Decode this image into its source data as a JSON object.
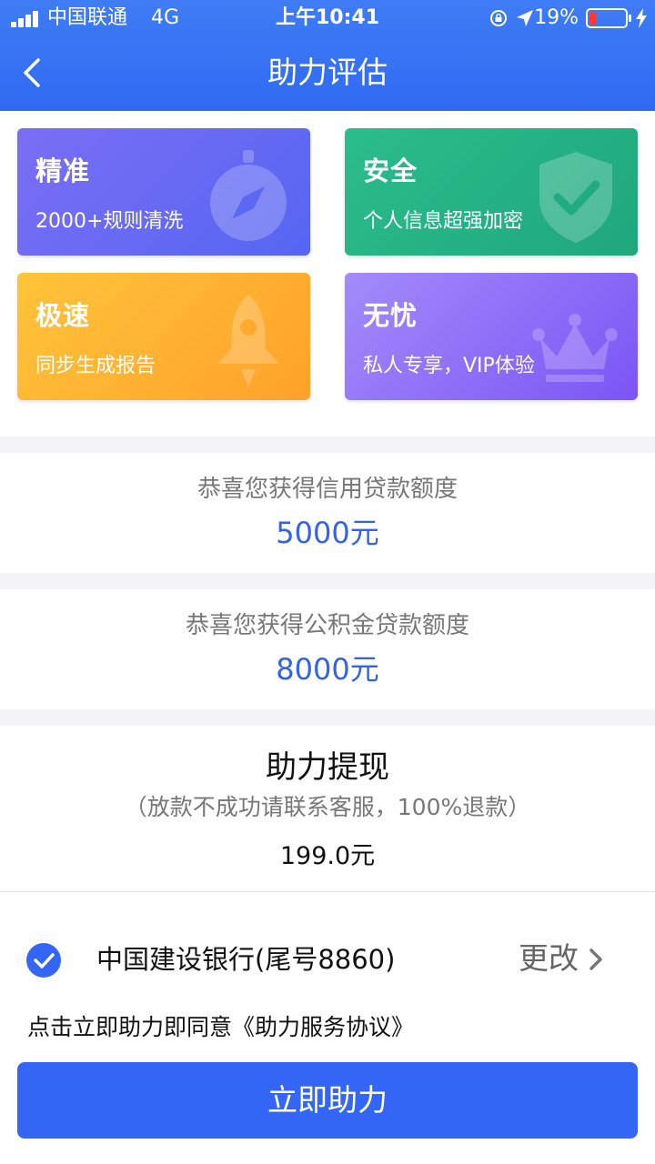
{
  "status_bar": {
    "carrier": "中国联通",
    "network": "4G",
    "time": "上午10:41",
    "battery_percent": "19%",
    "battery_level": 0.19,
    "battery_color": "#ff3b30"
  },
  "nav": {
    "back_icon": "chevron-left-icon",
    "title": "助力评估"
  },
  "features": [
    {
      "title": "精准",
      "desc": "2000+规则清洗",
      "icon": "compass-icon",
      "colors": [
        "#7b6ef5",
        "#5566f2"
      ]
    },
    {
      "title": "安全",
      "desc": "个人信息超强加密",
      "icon": "shield-check-icon",
      "colors": [
        "#2bbd8b",
        "#1fa77c"
      ]
    },
    {
      "title": "极速",
      "desc": "同步生成报告",
      "icon": "rocket-icon",
      "colors": [
        "#ffc43a",
        "#ffa12a"
      ]
    },
    {
      "title": "无忧",
      "desc": "私人专享，VIP体验",
      "icon": "crown-icon",
      "colors": [
        "#a38bfa",
        "#7b55f5"
      ]
    }
  ],
  "credit_quota": {
    "label": "恭喜您获得信用贷款额度",
    "amount": "5000元"
  },
  "fund_quota": {
    "label": "恭喜您获得公积金贷款额度",
    "amount": "8000元"
  },
  "withdraw": {
    "title": "助力提现",
    "note": "（放款不成功请联系客服，100%退款）",
    "amount": "199.0元"
  },
  "bank": {
    "name": "中国建设银行(尾号8860)",
    "change_label": "更改",
    "checked": true
  },
  "agreement": "点击立即助力即同意《助力服务协议》",
  "submit_label": "立即助力",
  "colors": {
    "primary": "#3366f5",
    "amount": "#3263e8"
  }
}
